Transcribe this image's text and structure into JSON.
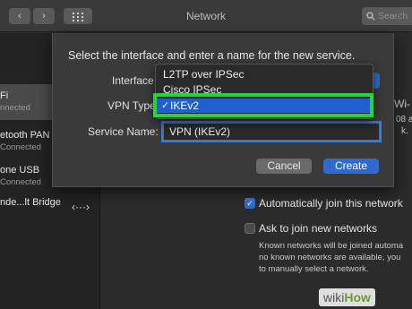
{
  "window": {
    "title": "Network"
  },
  "toolbar": {
    "back_glyph": "‹",
    "forward_glyph": "›",
    "search_placeholder": "Search",
    "icons": [
      "chevron-left-icon",
      "chevron-right-icon",
      "grid-icon",
      "search-icon"
    ]
  },
  "sidebar": {
    "items": [
      {
        "name": "Fi",
        "status": "nnected"
      },
      {
        "name": "etooth PAN",
        "status": "Connected"
      },
      {
        "name": "one USB",
        "status": "Connected"
      },
      {
        "name": "nde...lt Bridge",
        "status": ""
      }
    ],
    "selected_index": 0,
    "connector_glyph": "‹···›"
  },
  "dialog": {
    "prompt": "Select the interface and enter a name for the new service.",
    "interface_label": "Interface",
    "vpn_type_label": "VPN Type",
    "service_name_label": "Service Name:",
    "service_name_value": "VPN (IKEv2)",
    "vpn_type_options": [
      "L2TP over IPSec",
      "Cisco IPSec",
      "IKEv2"
    ],
    "vpn_type_selected": "IKEv2",
    "checkmark": "✓",
    "cancel_label": "Cancel",
    "create_label": "Create"
  },
  "behind_dialog": {
    "right_text_1": "Wi-",
    "right_text_2": "08 a",
    "right_text_3": "k."
  },
  "options": {
    "auto_join_label": "Automatically join this network",
    "auto_join_checked": true,
    "ask_join_label": "Ask to join new networks",
    "ask_join_checked": false,
    "note_lines": [
      "Known networks will be joined automa",
      "no known networks are available, you",
      "to manually select a network."
    ]
  },
  "watermark": {
    "part1": "wiki",
    "part2": "How"
  },
  "colors": {
    "accent": "#2f6ad0",
    "selection": "#1f5fd1",
    "highlight_box": "#22d838"
  }
}
